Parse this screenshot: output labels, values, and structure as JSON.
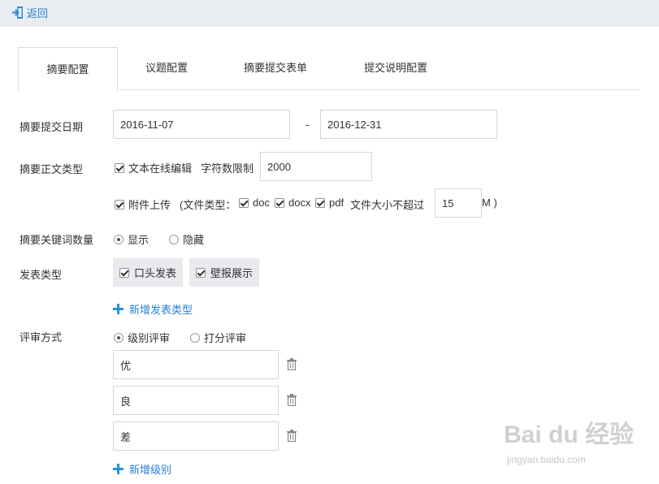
{
  "header": {
    "back_label": "返回"
  },
  "tabs": [
    {
      "label": "摘要配置",
      "active": true
    },
    {
      "label": "议题配置",
      "active": false
    },
    {
      "label": "摘要提交表单",
      "active": false
    },
    {
      "label": "提交说明配置",
      "active": false
    }
  ],
  "form": {
    "submit_date": {
      "label": "摘要提交日期",
      "start": "2016-11-07",
      "separator": "-",
      "end": "2016-12-31"
    },
    "body_type": {
      "label": "摘要正文类型",
      "online_edit": {
        "label": "文本在线编辑",
        "checked": true
      },
      "char_limit_label": "字符数限制",
      "char_limit_value": "2000",
      "attachment": {
        "label": "附件上传",
        "checked": true
      },
      "file_type_label": "(文件类型：",
      "file_types": [
        {
          "label": "doc",
          "checked": true
        },
        {
          "label": "docx",
          "checked": true
        },
        {
          "label": "pdf",
          "checked": true
        }
      ],
      "size_label": "文件大小不超过",
      "size_value": "15",
      "size_unit": "M )"
    },
    "keyword_count": {
      "label": "摘要关键词数量",
      "options": [
        {
          "label": "显示",
          "checked": true
        },
        {
          "label": "隐藏",
          "checked": false
        }
      ]
    },
    "present_type": {
      "label": "发表类型",
      "options": [
        {
          "label": "口头发表",
          "checked": true
        },
        {
          "label": "壁报展示",
          "checked": true
        }
      ],
      "add_label": "新增发表类型"
    },
    "review_method": {
      "label": "评审方式",
      "options": [
        {
          "label": "级别评审",
          "checked": true
        },
        {
          "label": "打分评审",
          "checked": false
        }
      ],
      "levels": [
        "优",
        "良",
        "差"
      ],
      "add_label": "新增级别"
    }
  },
  "watermark": {
    "brand": "Bai du 经验",
    "url": "jingyan.baidu.com"
  },
  "colors": {
    "link": "#2b7fd3",
    "topbar": "#e9edf2",
    "chip": "#e8eaed",
    "border": "#d5d5d5"
  }
}
